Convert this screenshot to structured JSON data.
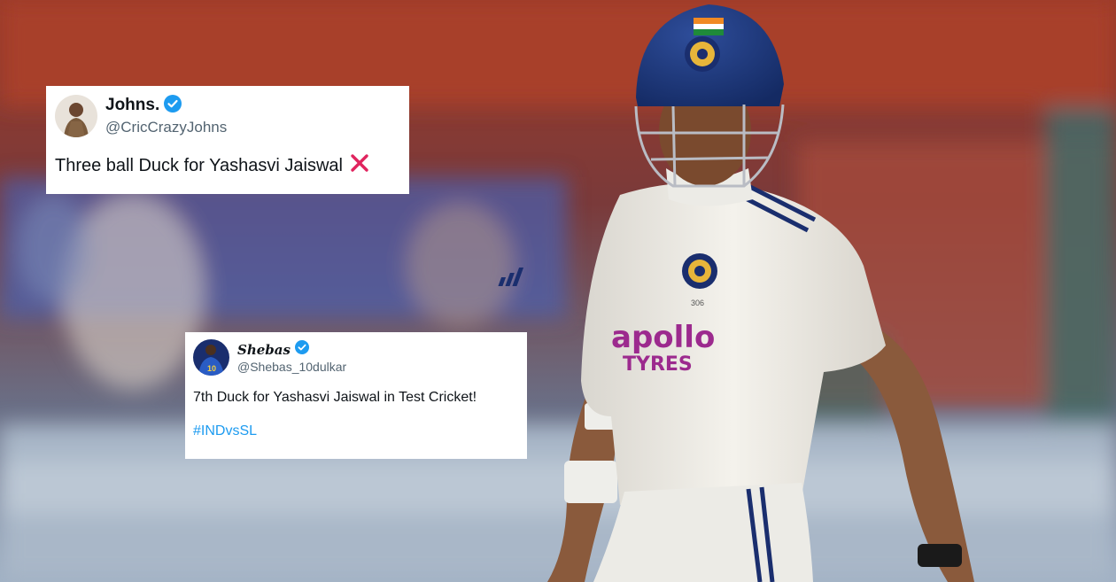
{
  "scene": {
    "description_icon": "photo-cricketer-walking-off"
  },
  "jersey": {
    "sponsor_line1": "apollo",
    "sponsor_line2": "TYRES",
    "number": "306"
  },
  "tweets": [
    {
      "name": "Johns.",
      "handle": "@CricCrazyJohns",
      "text": "Three ball Duck for Yashasvi Jaiswal",
      "emoji_icon": "cross-mark-icon"
    },
    {
      "name": "Shebas",
      "handle": "@Shebas_10dulkar",
      "text": "7th Duck for Yashasvi Jaiswal in Test Cricket!",
      "hashtag": "#INDvsSL",
      "avatar_jersey": "10"
    }
  ],
  "colors": {
    "verified": "#1d9bf0",
    "link": "#1d9bf0",
    "handle": "#536471",
    "cross": "#e0245e"
  }
}
